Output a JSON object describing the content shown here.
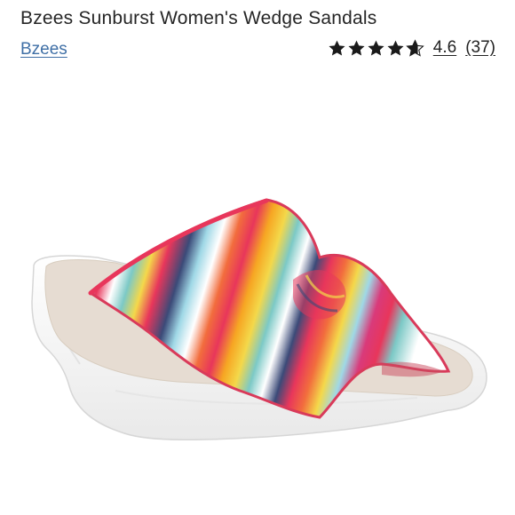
{
  "product": {
    "title": "Bzees Sunburst Women's Wedge Sandals",
    "brand": "Bzees"
  },
  "rating": {
    "value": "4.6",
    "count_label": "(37)",
    "stars_shown": 4.6,
    "max_stars": 5
  },
  "colors": {
    "link": "#3f6fa6",
    "text": "#262626",
    "sole": "#f7f7f7",
    "footbed": "#e6dcd2",
    "stripes": [
      "#e8365b",
      "#f6a623",
      "#f4d84a",
      "#3b4a78",
      "#7cc9c6",
      "#f26d3d",
      "#ffffff",
      "#9fd8e6",
      "#d93a7a"
    ]
  }
}
